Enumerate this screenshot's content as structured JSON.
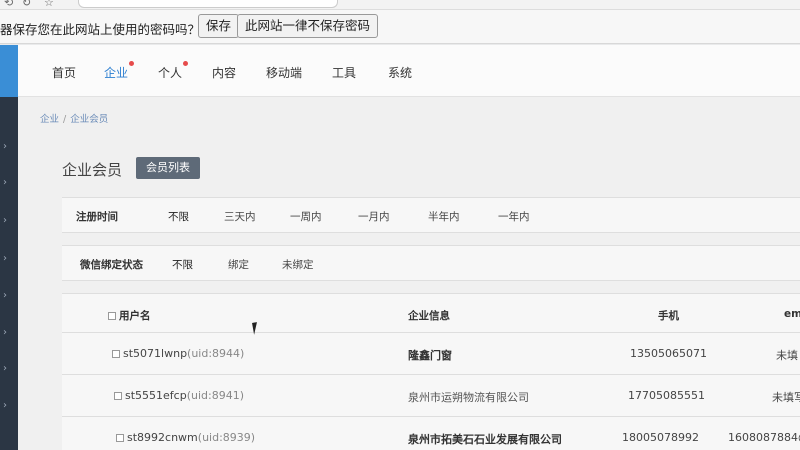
{
  "browser": {
    "save_prompt": "器保存您在此网站上使用的密码吗？",
    "save_button": "保存",
    "never_button": "此网站一律不保存密码"
  },
  "topnav": {
    "items": [
      {
        "label": "首页",
        "active": false,
        "badge": false
      },
      {
        "label": "企业",
        "active": true,
        "badge": true
      },
      {
        "label": "个人",
        "active": false,
        "badge": true
      },
      {
        "label": "内容",
        "active": false,
        "badge": false
      },
      {
        "label": "移动端",
        "active": false,
        "badge": false
      },
      {
        "label": "工具",
        "active": false,
        "badge": false
      },
      {
        "label": "系统",
        "active": false,
        "badge": false
      }
    ]
  },
  "breadcrumb": {
    "items": [
      "企业",
      "企业会员"
    ],
    "separator": "/"
  },
  "page": {
    "title": "企业会员",
    "tab_label": "会员列表"
  },
  "filters": {
    "register_time": {
      "label": "注册时间",
      "options": [
        "不限",
        "三天内",
        "一周内",
        "一月内",
        "半年内",
        "一年内"
      ],
      "selected": "不限"
    },
    "wechat_bind": {
      "label": "微信绑定状态",
      "options": [
        "不限",
        "绑定",
        "未绑定"
      ],
      "selected": "不限"
    }
  },
  "table": {
    "headers": {
      "username": "用户名",
      "company": "企业信息",
      "phone": "手机",
      "email": "em"
    },
    "rows": [
      {
        "username": "st5071lwnp",
        "uid": "(uid:8944)",
        "company": "隆鑫门窗",
        "phone": "13505065071",
        "email": "未填"
      },
      {
        "username": "st5551efcp",
        "uid": "(uid:8941)",
        "company": "泉州市运朔物流有限公司",
        "phone": "17705085551",
        "email": "未填写"
      },
      {
        "username": "st8992cnwm",
        "uid": "(uid:8939)",
        "company": "泉州市拓美石石业发展有限公司",
        "phone": "18005078992",
        "email": "1608087884@"
      }
    ]
  },
  "colors": {
    "accent": "#2d7fd0",
    "sidebar": "#2b3644",
    "tab_button": "#5e6a78",
    "badge": "#e64b4b"
  }
}
